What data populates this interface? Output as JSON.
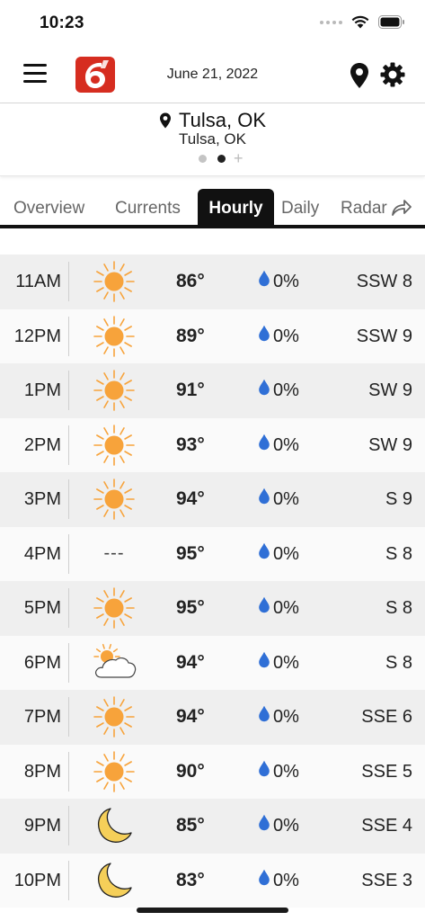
{
  "status_bar": {
    "time": "10:23"
  },
  "header": {
    "date": "June 21, 2022",
    "logo_color": "#d62d20"
  },
  "location": {
    "primary": "Tulsa, OK",
    "secondary": "Tulsa, OK",
    "page_count": 2,
    "active_page": 2
  },
  "tabs": [
    {
      "label": "Overview",
      "active": false
    },
    {
      "label": "Currents",
      "active": false
    },
    {
      "label": "Hourly",
      "active": true
    },
    {
      "label": "Daily",
      "active": false
    },
    {
      "label": "Radar",
      "active": false
    }
  ],
  "hourly": [
    {
      "time": "11AM",
      "icon": "sun-icon",
      "temp": "86°",
      "precip": "0%",
      "wind": "SSW 8"
    },
    {
      "time": "12PM",
      "icon": "sun-icon",
      "temp": "89°",
      "precip": "0%",
      "wind": "SSW 9"
    },
    {
      "time": "1PM",
      "icon": "sun-icon",
      "temp": "91°",
      "precip": "0%",
      "wind": "SW 9"
    },
    {
      "time": "2PM",
      "icon": "sun-icon",
      "temp": "93°",
      "precip": "0%",
      "wind": "SW 9"
    },
    {
      "time": "3PM",
      "icon": "sun-icon",
      "temp": "94°",
      "precip": "0%",
      "wind": "S 9"
    },
    {
      "time": "4PM",
      "icon": "no-data",
      "icon_text": "---",
      "temp": "95°",
      "precip": "0%",
      "wind": "S 8"
    },
    {
      "time": "5PM",
      "icon": "sun-icon",
      "temp": "95°",
      "precip": "0%",
      "wind": "S 8"
    },
    {
      "time": "6PM",
      "icon": "partly-cloudy-icon",
      "temp": "94°",
      "precip": "0%",
      "wind": "S 8"
    },
    {
      "time": "7PM",
      "icon": "sun-icon",
      "temp": "94°",
      "precip": "0%",
      "wind": "SSE 6"
    },
    {
      "time": "8PM",
      "icon": "sun-icon",
      "temp": "90°",
      "precip": "0%",
      "wind": "SSE 5"
    },
    {
      "time": "9PM",
      "icon": "moon-icon",
      "temp": "85°",
      "precip": "0%",
      "wind": "SSE 4"
    },
    {
      "time": "10PM",
      "icon": "moon-icon",
      "temp": "83°",
      "precip": "0%",
      "wind": "SSE 3"
    }
  ],
  "colors": {
    "sun": "#f7a33b",
    "moon": "#f5cf59",
    "raindrop": "#2f6fd6",
    "row_shaded": "#efefef",
    "row_plain": "#fafafa",
    "tab_active_bg": "#111111"
  }
}
